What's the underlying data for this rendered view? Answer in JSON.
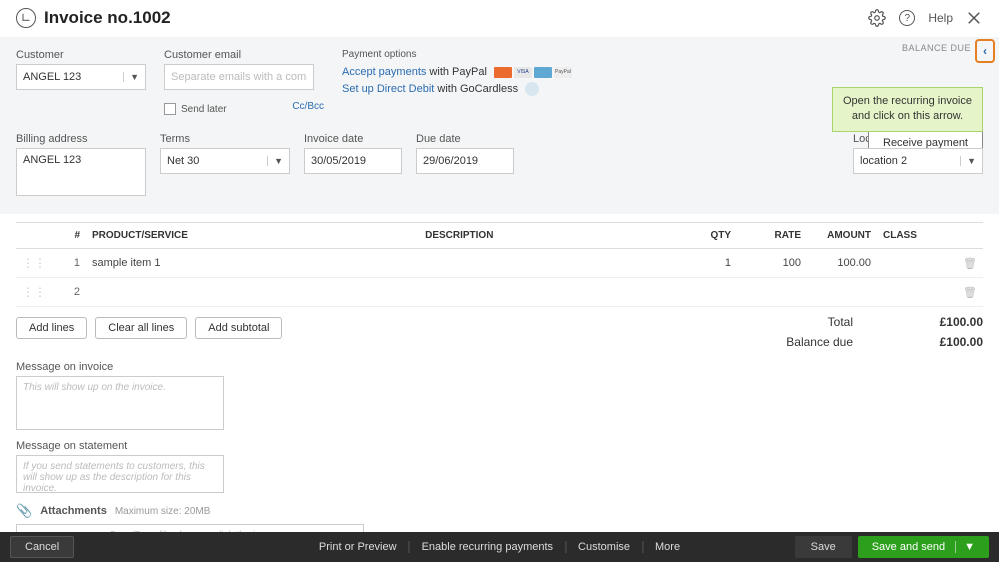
{
  "header": {
    "title": "Invoice no.1002",
    "help": "Help"
  },
  "balance_due_label": "BALANCE DUE",
  "tooltip": {
    "line1": "Open the recurring invoice",
    "line2": "and  click on this arrow."
  },
  "receive_payment": "Receive payment",
  "customer": {
    "label": "Customer",
    "value": "ANGEL 123"
  },
  "customer_email": {
    "label": "Customer email",
    "placeholder": "Separate emails with a comma",
    "send_later": "Send later",
    "ccbcc": "Cc/Bcc"
  },
  "payment": {
    "title": "Payment options",
    "accept_link": "Accept payments",
    "accept_rest": " with PayPal",
    "direct_link": "Set up Direct Debit",
    "direct_rest": " with GoCardless"
  },
  "billing": {
    "label": "Billing address",
    "value": "ANGEL 123"
  },
  "terms": {
    "label": "Terms",
    "value": "Net 30"
  },
  "invoice_date": {
    "label": "Invoice date",
    "value": "30/05/2019"
  },
  "due_date": {
    "label": "Due date",
    "value": "29/06/2019"
  },
  "location": {
    "label": "Location",
    "value": "location 2"
  },
  "columns": {
    "num": "#",
    "product": "PRODUCT/SERVICE",
    "description": "DESCRIPTION",
    "qty": "QTY",
    "rate": "RATE",
    "amount": "AMOUNT",
    "class": "CLASS"
  },
  "rows": [
    {
      "num": "1",
      "product": "sample item 1",
      "qty": "1",
      "rate": "100",
      "amount": "100.00"
    },
    {
      "num": "2",
      "product": "",
      "qty": "",
      "rate": "",
      "amount": ""
    }
  ],
  "buttons": {
    "add_lines": "Add lines",
    "clear_all": "Clear all lines",
    "add_subtotal": "Add subtotal"
  },
  "totals": {
    "total_label": "Total",
    "total_value": "£100.00",
    "balance_label": "Balance due",
    "balance_value": "£100.00"
  },
  "message_invoice": {
    "label": "Message on invoice",
    "placeholder": "This will show up on the invoice."
  },
  "message_statement": {
    "label": "Message on statement",
    "placeholder": "If you send statements to customers, this will show up as the description for this invoice."
  },
  "attachments": {
    "label": "Attachments",
    "max": "Maximum size: 20MB",
    "drop": "Drag/Drop files here or click the icon"
  },
  "footer": {
    "cancel": "Cancel",
    "print": "Print or Preview",
    "recurring": "Enable recurring payments",
    "customise": "Customise",
    "more": "More",
    "save": "Save",
    "save_send": "Save and send"
  }
}
